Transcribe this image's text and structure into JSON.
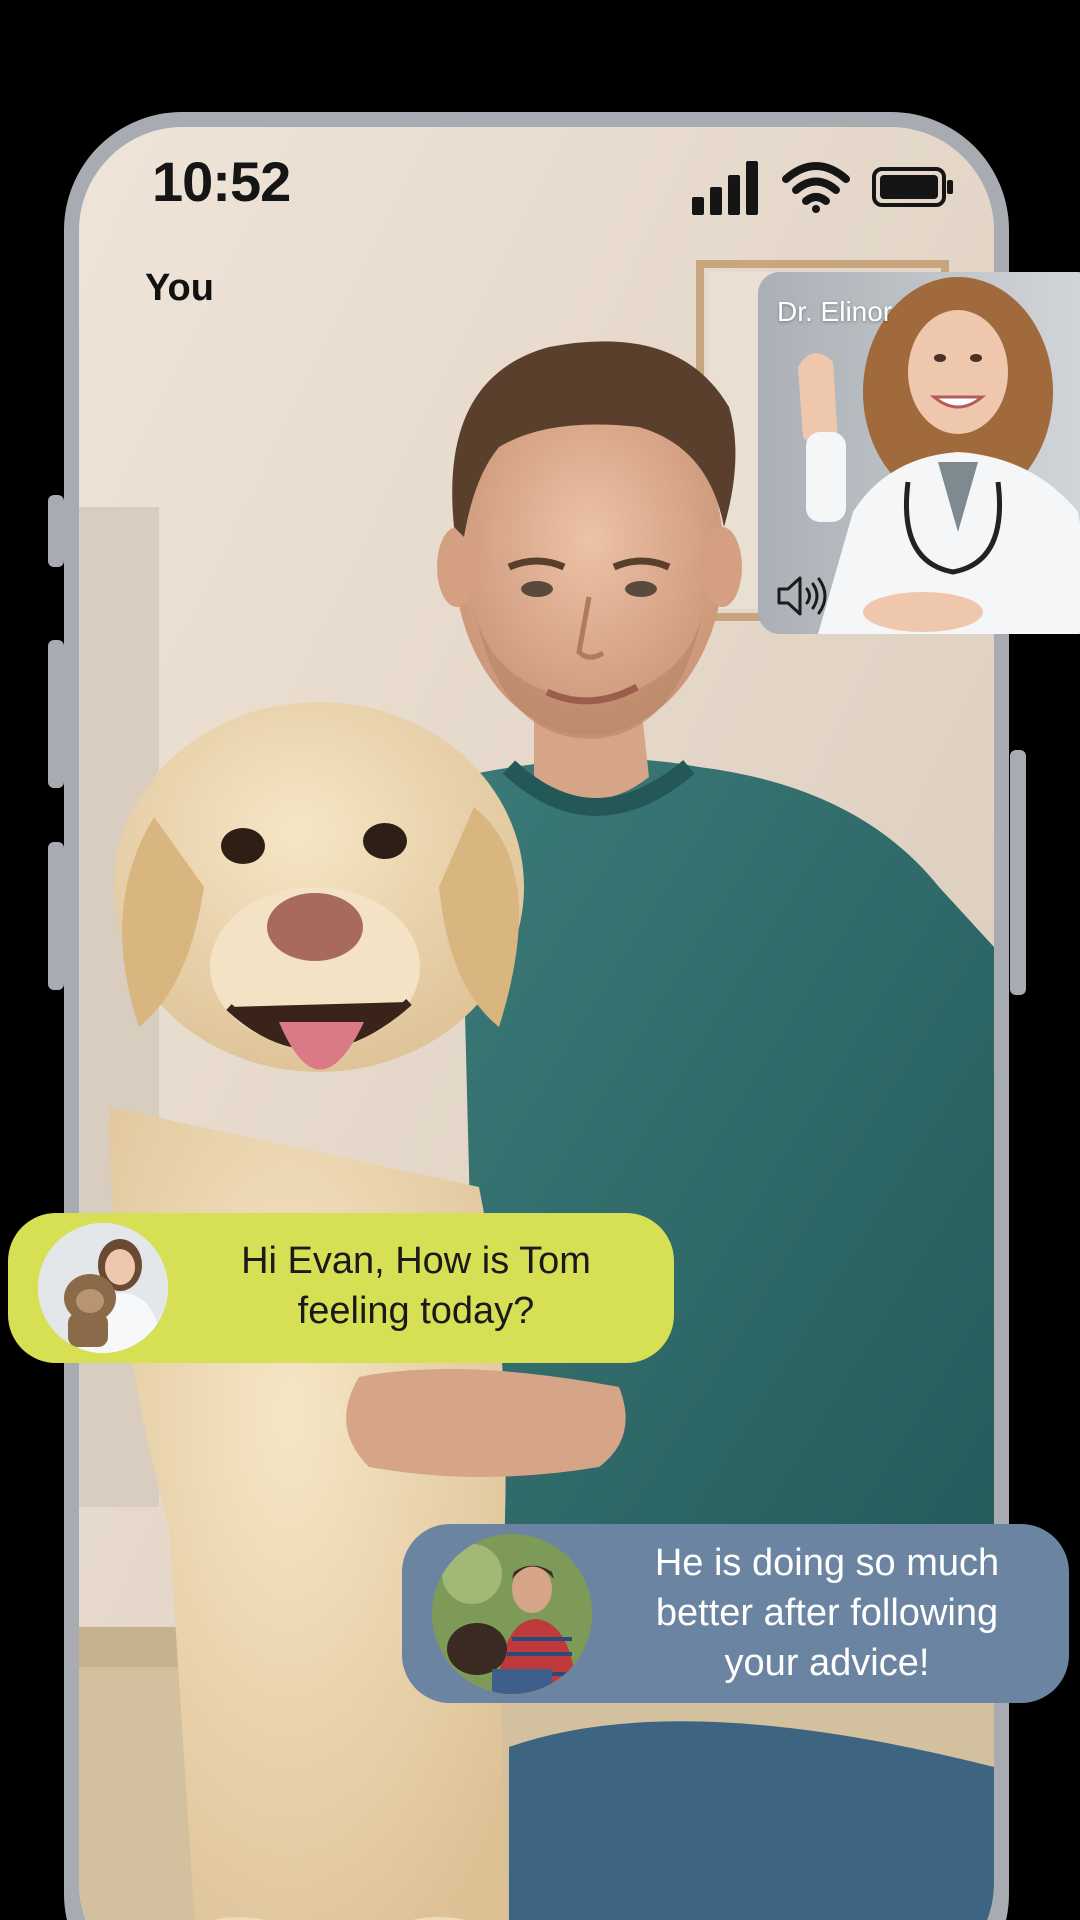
{
  "status_bar": {
    "time": "10:52",
    "icons": [
      "cellular-signal-icon",
      "wifi-icon",
      "battery-icon"
    ]
  },
  "local_video": {
    "label": "You"
  },
  "remote_video": {
    "name": "Dr. Elinor",
    "audio_icon": "speaker-icon"
  },
  "messages": [
    {
      "sender": "doctor",
      "text_line1": "Hi Evan, How is Tom",
      "text_line2": "feeling today?",
      "bubble_color": "#d7df55"
    },
    {
      "sender": "owner",
      "text_line1": "He is doing so much",
      "text_line2": "better after following",
      "text_line3": "your advice!",
      "bubble_color": "#6b84a1"
    }
  ],
  "colors": {
    "background": "#000000",
    "phone_frame": "#a9abb3",
    "wall": "#e6dbd0",
    "sweater": "#2f6b6a",
    "dog": "#ecd7b0"
  }
}
